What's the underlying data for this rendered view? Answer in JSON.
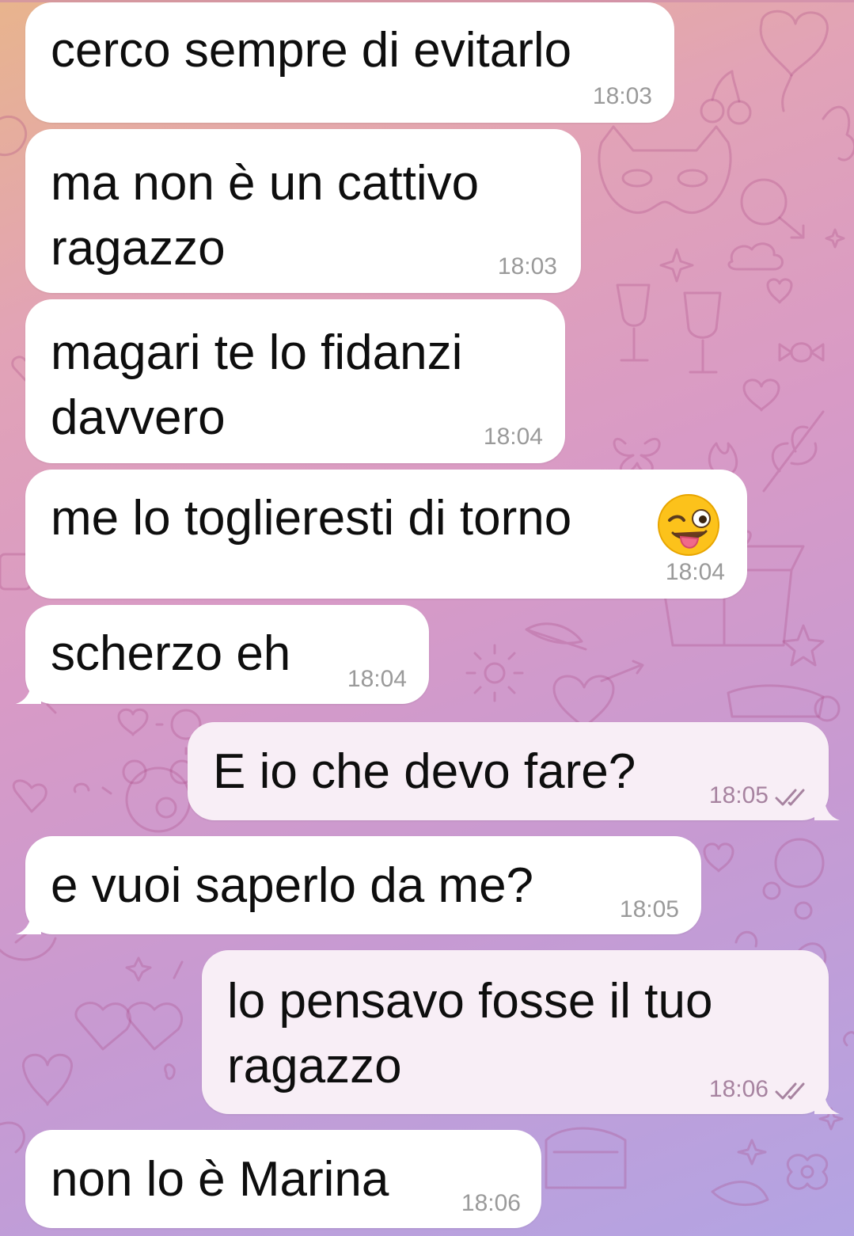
{
  "chat": {
    "theme": {
      "incoming_bubble": "#ffffff",
      "outgoing_bubble": "#f8eef6",
      "read_tick_color": "#a783a0",
      "wallpaper_gradient": [
        "#e8b48d",
        "#d89ac6",
        "#b3a4e3"
      ]
    },
    "messages": [
      {
        "direction": "incoming",
        "lines": [
          "cerco sempre di evitarlo"
        ],
        "time": "18:03"
      },
      {
        "direction": "incoming",
        "lines": [
          "ma non è un cattivo",
          "ragazzo"
        ],
        "time": "18:03"
      },
      {
        "direction": "incoming",
        "lines": [
          "magari te lo fidanzi",
          "davvero"
        ],
        "time": "18:04"
      },
      {
        "direction": "incoming",
        "lines": [
          "me lo toglieresti di torno"
        ],
        "time": "18:04",
        "emoji": "winking-face-with-tongue-icon"
      },
      {
        "direction": "incoming",
        "lines": [
          "scherzo eh"
        ],
        "time": "18:04"
      },
      {
        "direction": "outgoing",
        "lines": [
          "E io che devo fare?"
        ],
        "time": "18:05",
        "status": "read-double-check-icon"
      },
      {
        "direction": "incoming",
        "lines": [
          "e vuoi saperlo da me?"
        ],
        "time": "18:05"
      },
      {
        "direction": "outgoing",
        "lines": [
          "lo pensavo fosse il tuo",
          "ragazzo"
        ],
        "time": "18:06",
        "status": "read-double-check-icon"
      },
      {
        "direction": "incoming",
        "lines": [
          "non lo è Marina"
        ],
        "time": "18:06"
      }
    ]
  }
}
